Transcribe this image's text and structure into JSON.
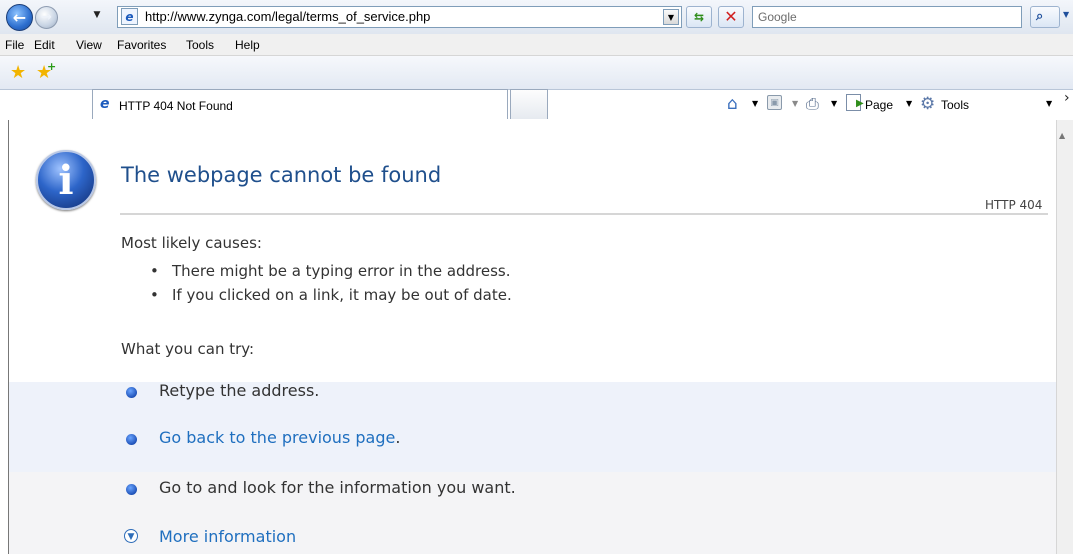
{
  "toolbar": {
    "url": "http://www.zynga.com/legal/terms_of_service.php",
    "search_placeholder": "Google"
  },
  "menu": [
    "File",
    "Edit",
    "View",
    "Favorites",
    "Tools",
    "Help"
  ],
  "tab": {
    "title": "HTTP 404 Not Found"
  },
  "command_bar": {
    "page_label": "Page",
    "tools_label": "Tools"
  },
  "content": {
    "heading": "The webpage cannot be found",
    "code": "HTTP 404",
    "causes_title": "Most likely causes:",
    "causes": [
      "There might be a typing error in the address.",
      "If you clicked on a link, it may be out of date."
    ],
    "try_title": "What you can try:",
    "try_items": [
      {
        "text": "Retype the address."
      },
      {
        "link": "Go back to the previous page",
        "suffix": "."
      },
      {
        "text": "Go to  and look for the information you want."
      }
    ],
    "more_info": "More information"
  }
}
